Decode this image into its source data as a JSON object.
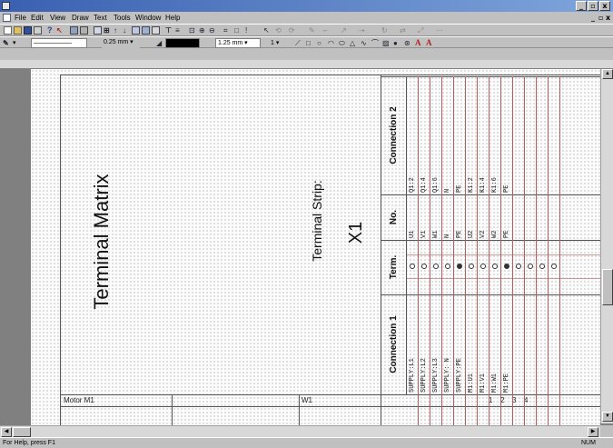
{
  "menu": {
    "items": [
      "File",
      "Edit",
      "View",
      "Draw",
      "Text",
      "Tools",
      "Window",
      "Help"
    ]
  },
  "toolbar2": {
    "line_width_1": "0.25 mm",
    "line_width_2": "1.25 mm",
    "page_number": "1"
  },
  "drawing": {
    "matrix_title": "Terminal Matrix",
    "strip_label": "Terminal Strip:",
    "strip_name": "X1",
    "header_connection1": "Connection 1",
    "header_term": "Term.",
    "header_no": "No.",
    "header_connection2": "Connection 2",
    "rows": [
      {
        "connection1": "SUPPLY:L1",
        "no": "U1",
        "connection2": "Q1:2",
        "bridged": false
      },
      {
        "connection1": "SUPPLY:L2",
        "no": "V1",
        "connection2": "Q1:4",
        "bridged": false
      },
      {
        "connection1": "SUPPLY:L3",
        "no": "W1",
        "connection2": "Q1:6",
        "bridged": false
      },
      {
        "connection1": "SUPPLY: N",
        "no": "N",
        "connection2": "N",
        "bridged": false
      },
      {
        "connection1": "SUPPLY:PE",
        "no": "PE",
        "connection2": "PE",
        "bridged": true
      },
      {
        "connection1": "M1:U1",
        "no": "U2",
        "connection2": "K1:2",
        "bridged": false
      },
      {
        "connection1": "M1:V1",
        "no": "V2",
        "connection2": "K1:4",
        "bridged": false
      },
      {
        "connection1": "M1:W1",
        "no": "W2",
        "connection2": "K1:6",
        "bridged": false
      },
      {
        "connection1": "M1:PE",
        "no": "PE",
        "connection2": "PE",
        "bridged": true
      },
      {
        "connection1": "",
        "no": "",
        "connection2": "",
        "bridged": false
      },
      {
        "connection1": "",
        "no": "",
        "connection2": "",
        "bridged": false
      },
      {
        "connection1": "",
        "no": "",
        "connection2": "",
        "bridged": false
      },
      {
        "connection1": "",
        "no": "",
        "connection2": "",
        "bridged": false
      }
    ],
    "bottom_motor": "Motor  M1",
    "bottom_cable": "W1",
    "bottom_cores": [
      "1",
      "2",
      "3",
      "4"
    ]
  },
  "status": {
    "help_text": "For Help, press F1",
    "num_indicator": "NUM"
  },
  "colors": {
    "titlebar": "#3a5fb0",
    "page": "#fbfbfb",
    "red_grid": "#b06060"
  }
}
